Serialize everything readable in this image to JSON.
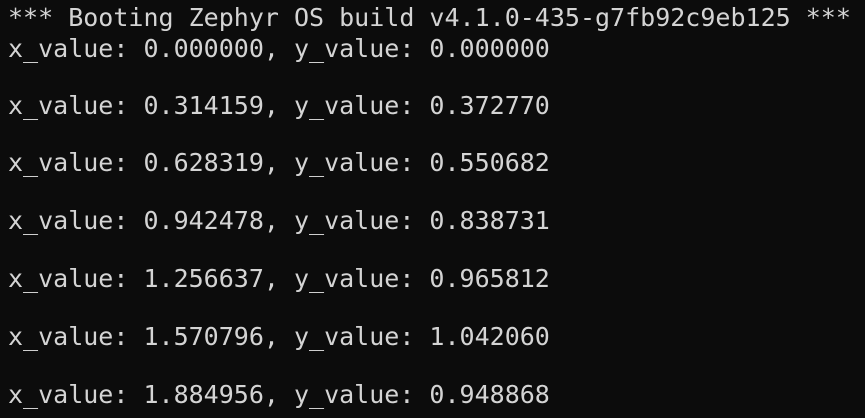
{
  "terminal": {
    "background": "#0c0c0c",
    "foreground": "#d4d4d4",
    "banner": "*** Booting Zephyr OS build v4.1.0-435-g7fb92c9eb125 ***",
    "lines": [
      "x_value: 0.000000, y_value: 0.000000",
      "x_value: 0.314159, y_value: 0.372770",
      "x_value: 0.628319, y_value: 0.550682",
      "x_value: 0.942478, y_value: 0.838731",
      "x_value: 1.256637, y_value: 0.965812",
      "x_value: 1.570796, y_value: 1.042060",
      "x_value: 1.884956, y_value: 0.948868"
    ]
  }
}
